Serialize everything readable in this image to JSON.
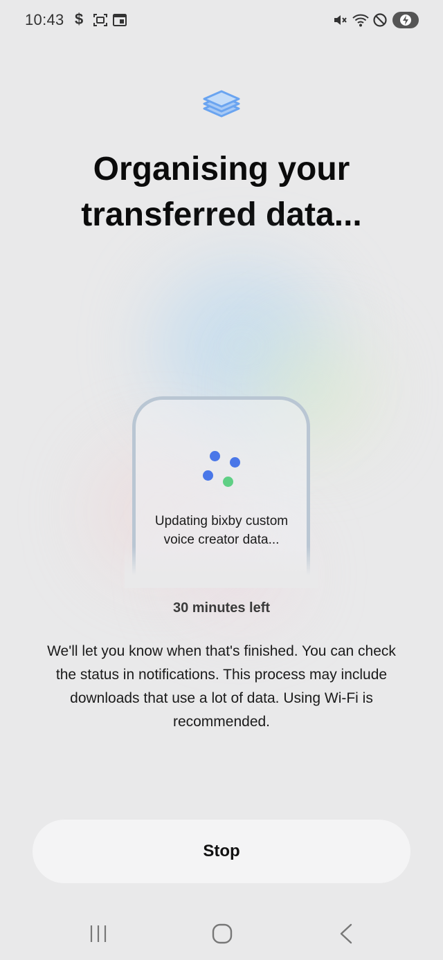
{
  "status_bar": {
    "time": "10:43",
    "dollar": "$",
    "icons": [
      "dollar-icon",
      "screen-scan-icon",
      "calendar-card-icon",
      "mute-icon",
      "wifi-icon",
      "do-not-disturb-icon",
      "battery-charging-icon"
    ]
  },
  "header": {
    "app_icon": "layers-icon",
    "title": "Organising your\ntransferred data..."
  },
  "illustration": {
    "progress_text": "Updating bixby custom\nvoice creator data..."
  },
  "time_left": "30 minutes left",
  "description": "We'll let you know when that's finished. You can check the status in notifications. This process may include downloads that use a lot of data. Using Wi-Fi is recommended.",
  "actions": {
    "stop_label": "Stop"
  },
  "nav_bar": {
    "items": [
      "recents-icon",
      "home-icon",
      "back-icon"
    ]
  },
  "colors": {
    "background": "#e9e9ea",
    "accent_blue": "#4a77e8",
    "accent_green": "#5fcf85",
    "icon_blue": "#6aa4f0",
    "button_bg": "#f4f4f5"
  }
}
